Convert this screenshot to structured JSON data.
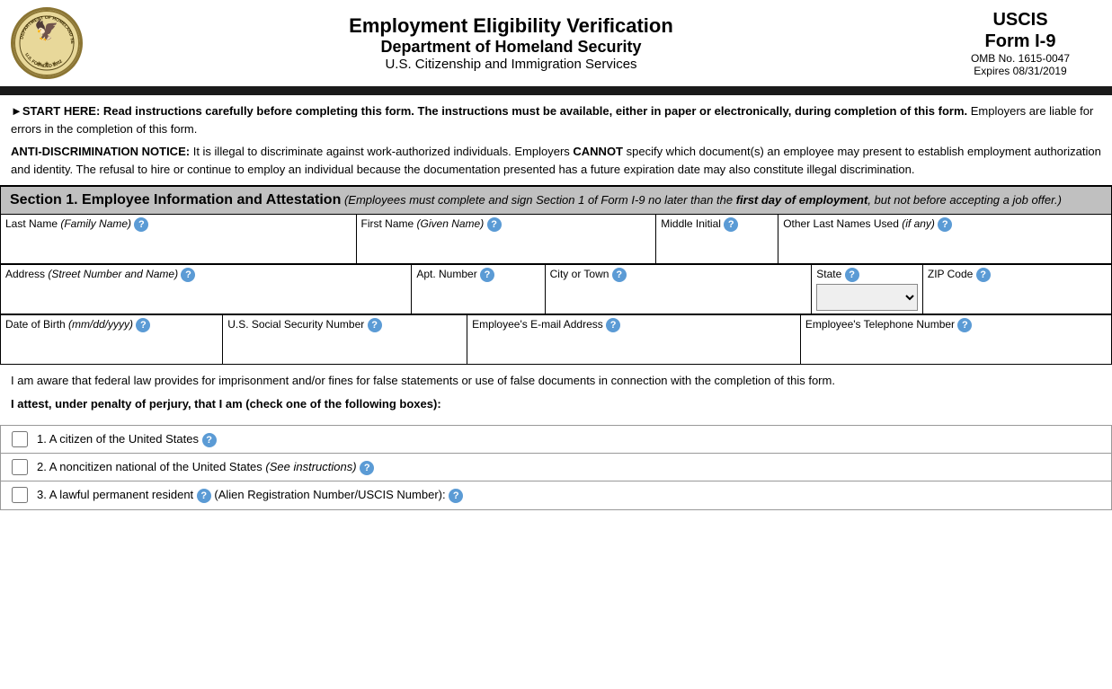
{
  "header": {
    "title1": "Employment Eligibility Verification",
    "title2": "Department of Homeland Security",
    "title3": "U.S. Citizenship and Immigration Services",
    "form_title": "USCIS\nForm I-9",
    "omb": "OMB No. 1615-0047",
    "expires": "Expires 08/31/2019",
    "seal_alt": "Department of Homeland Security Seal"
  },
  "start_notice": "►START HERE: Read instructions carefully before completing this form. The instructions must be available, either in paper or electronically, during completion of this form. Employers are liable for errors in the completion of this form.",
  "anti_disc_label": "ANTI-DISCRIMINATION NOTICE:",
  "anti_disc_text": " It is illegal to discriminate against work-authorized individuals. Employers CANNOT specify which document(s) an employee may present to establish employment authorization and identity. The refusal to hire or continue to employ an individual because the documentation presented has a future expiration date may also constitute illegal discrimination.",
  "section1": {
    "title": "Section 1. Employee Information and Attestation",
    "subtitle": "(Employees must complete and sign Section 1 of Form I-9 no later than the first day of employment, but not before accepting a job offer.)"
  },
  "fields": {
    "last_name_label": "Last Name",
    "last_name_sub": "(Family Name)",
    "first_name_label": "First Name",
    "first_name_sub": "(Given Name)",
    "middle_initial_label": "Middle Initial",
    "other_names_label": "Other Last Names Used",
    "other_names_sub": "(if any)",
    "address_label": "Address",
    "address_sub": "(Street Number and Name)",
    "apt_label": "Apt. Number",
    "city_label": "City or Town",
    "state_label": "State",
    "zip_label": "ZIP Code",
    "dob_label": "Date of Birth",
    "dob_sub": "(mm/dd/yyyy)",
    "ssn_label": "U.S. Social Security Number",
    "email_label": "Employee's E-mail Address",
    "phone_label": "Employee's Telephone Number"
  },
  "attestation": {
    "para1": "I am aware that federal law provides for imprisonment and/or fines for false statements or use of false documents in connection with the completion of this form.",
    "para2": "I attest, under penalty of perjury, that I am (check one of the following boxes):",
    "options": [
      {
        "id": "opt1",
        "text": "1. A citizen of the United States"
      },
      {
        "id": "opt2",
        "text": "2. A noncitizen national of the United States",
        "sub": "(See instructions)"
      },
      {
        "id": "opt3",
        "text": "3. A lawful permanent resident",
        "sub": "(Alien Registration Number/USCIS Number):"
      }
    ]
  },
  "help_icon_label": "?"
}
